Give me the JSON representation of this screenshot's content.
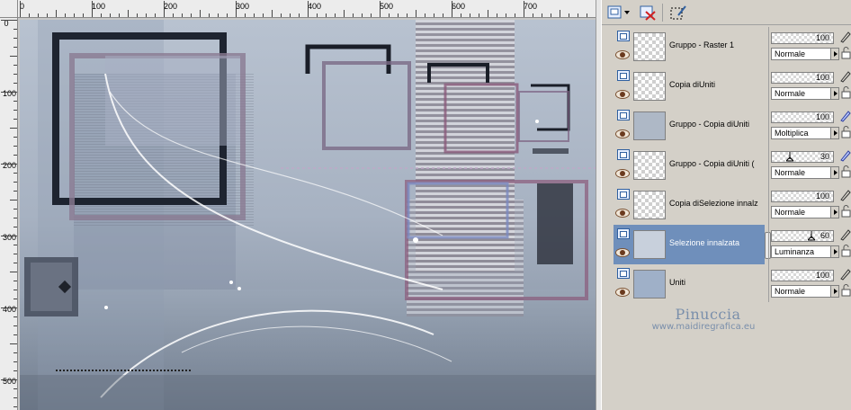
{
  "rulers": {
    "top_labels": [
      "0",
      "100",
      "200",
      "300",
      "400",
      "500",
      "600",
      "700"
    ],
    "left_labels": [
      "0",
      "100",
      "200",
      "300",
      "400",
      "500"
    ]
  },
  "layers": [
    {
      "name": "Gruppo - Raster 1",
      "selected": false
    },
    {
      "name": "Copia diUniti",
      "selected": false
    },
    {
      "name": "Gruppo - Copia diUniti",
      "selected": false
    },
    {
      "name": "Gruppo - Copia diUniti (",
      "selected": false
    },
    {
      "name": "Copia diSelezione innalz",
      "selected": false
    },
    {
      "name": "Selezione innalzata",
      "selected": true
    },
    {
      "name": "Uniti",
      "selected": false
    }
  ],
  "layer_props": [
    {
      "opacity": "100",
      "blend": "Normale"
    },
    {
      "opacity": "100",
      "blend": "Normale"
    },
    {
      "opacity": "100",
      "blend": "Moltiplica"
    },
    {
      "opacity": "30",
      "blend": "Normale"
    },
    {
      "opacity": "100",
      "blend": "Normale"
    },
    {
      "opacity": "60",
      "blend": "Luminanza"
    },
    {
      "opacity": "100",
      "blend": "Normale"
    }
  ],
  "watermark": {
    "name": "Pinuccia",
    "url": "www.maidiregrafica.eu"
  },
  "colors": {
    "selection": "#6f8fbb",
    "panel_bg": "#d4d0c8",
    "watermark": "#7a8fab"
  }
}
